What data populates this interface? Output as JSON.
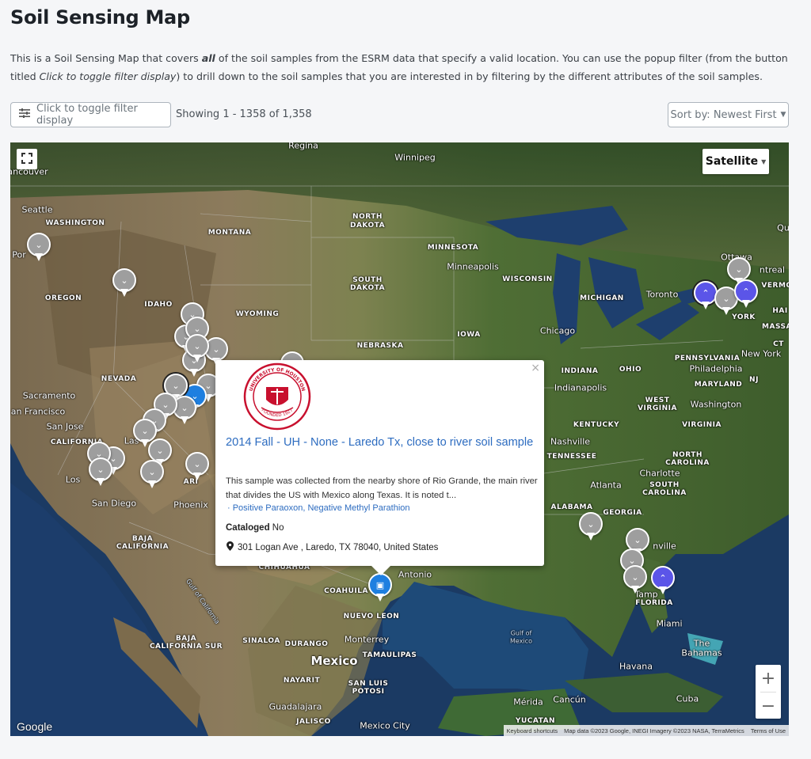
{
  "page": {
    "title": "Soil Sensing Map",
    "intro_part1": "This is a Soil Sensing Map that covers ",
    "intro_bold": "all",
    "intro_part2": " of the soil samples from the ESRM data that specify a valid location. You can use the popup filter (from the button titled ",
    "intro_italic": "Click to toggle filter display",
    "intro_part3": ") to drill down to the soil samples that you are interested in by filtering by the different attributes of the soil samples."
  },
  "toolbar": {
    "filter_label": "Click to toggle filter display",
    "showing": "Showing 1 - 1358 of 1,358",
    "sort_label": "Sort by: Newest First"
  },
  "map": {
    "type_label": "Satellite",
    "google": "Google",
    "attribution": {
      "shortcuts": "Keyboard shortcuts",
      "data": "Map data ©2023 Google, INEGI Imagery ©2023 NASA, TerraMetrics",
      "terms": "Terms of Use"
    },
    "labels": {
      "regina": "Regina",
      "winnipeg": "Winnipeg",
      "vancouver": "ancouver",
      "seattle": "Seattle",
      "washington": "WASHINGTON",
      "montana": "MONTANA",
      "north_dakota_1": "NORTH",
      "north_dakota_2": "DAKOTA",
      "minnesota": "MINNESOTA",
      "minneapolis": "Minneapolis",
      "portland": "Por",
      "oregon": "OREGON",
      "idaho": "IDAHO",
      "south_dakota_1": "SOUTH",
      "south_dakota_2": "DAKOTA",
      "wisconsin": "WISCONSIN",
      "michigan": "MICHIGAN",
      "toronto": "Toronto",
      "ottawa": "Ottawa",
      "montreal": "ntreal",
      "wyoming": "WYOMING",
      "iowa": "IOWA",
      "chicago": "Chicago",
      "nebraska": "NEBRASKA",
      "pennsylvania": "PENNSYLVANIA",
      "new_york_state": "YORK",
      "new_york": "New York",
      "philadelphia": "Philadelphia",
      "nevada": "NEVADA",
      "sacramento": "Sacramento",
      "san_francisco": "an Francisco",
      "san_jose": "San Jose",
      "california": "CALIFORNIA",
      "indiana": "INDIANA",
      "ohio": "OHIO",
      "indianapolis": "Indianapolis",
      "maryland": "MARYLAND",
      "west_virginia_1": "WEST",
      "west_virginia_2": "VIRGINIA",
      "washington_dc": "Washington",
      "kentucky": "KENTUCKY",
      "virginia": "VIRGINIA",
      "nashville": "Nashville",
      "tennessee": "TENNESSEE",
      "north_carolina_1": "NORTH",
      "north_carolina_2": "CAROLINA",
      "charlotte": "Charlotte",
      "atlanta": "Atlanta",
      "south_carolina_1": "SOUTH",
      "south_carolina_2": "CAROLINA",
      "alabama": "ALABAMA",
      "georgia": "GEORGIA",
      "los_angeles": "Los",
      "las_vegas": "Las",
      "arizona": "ARI",
      "san_diego": "San Diego",
      "phoenix": "Phoenix",
      "baja_1": "BAJA",
      "baja_2": "CALIFORNIA",
      "chihuahua": "CHIHUAHUA",
      "coahuila": "COAHUILA",
      "san_antonio": "Antonio",
      "nuevo_leon": "NUEVO LEON",
      "monterrey": "Monterrey",
      "sinaloa": "SINALOA",
      "durango": "DURANGO",
      "mexico": "Mexico",
      "tamaulipas": "TAMAULIPAS",
      "baja_sur_1": "BAJA",
      "baja_sur_2": "CALIFORNIA SUR",
      "gulf_ca": "Gulf of California",
      "gulf_mx_1": "Gulf of",
      "gulf_mx_2": "Mexico",
      "nayarit": "NAYARIT",
      "san_luis_1": "SAN LUIS",
      "san_luis_2": "POTOSI",
      "guadalajara": "Guadalajara",
      "jalisco": "JALISCO",
      "mexico_city": "Mexico City",
      "merida": "Mérida",
      "cancun": "Cancún",
      "yucatan": "YUCATAN",
      "havana": "Havana",
      "cuba": "Cuba",
      "miami": "Miami",
      "tampa": "Tamp",
      "florida": "FLORIDA",
      "bahamas_1": "The",
      "bahamas_2": "Bahamas",
      "jacksonville": "nville",
      "quebec": "Qu",
      "vermont": "VERMO",
      "massachusetts": "MASSA",
      "ct": "CT",
      "nj": "NJ",
      "ham": "HAI"
    }
  },
  "popup": {
    "title": "2014 Fall - UH - None - Laredo Tx, close to river soil sample",
    "description": "This sample was collected from the nearby shore of Rio Grande, the main river that divides the US with Mexico along Texas. It is noted t...",
    "tags": "· Positive Paraoxon, Negative Methyl Parathion",
    "cataloged_label": "Cataloged",
    "cataloged_value": "No",
    "address": "301 Logan Ave , Laredo, TX 78040, United States",
    "logo_top": "UNIVERSITY OF HOUSTON",
    "logo_bottom": "FOUNDED 1927"
  },
  "colors": {
    "pin_gray": "#9e9e9e",
    "pin_purple": "#5b55e8",
    "pin_blue": "#1e7fe0",
    "link": "#2d6cc0"
  }
}
